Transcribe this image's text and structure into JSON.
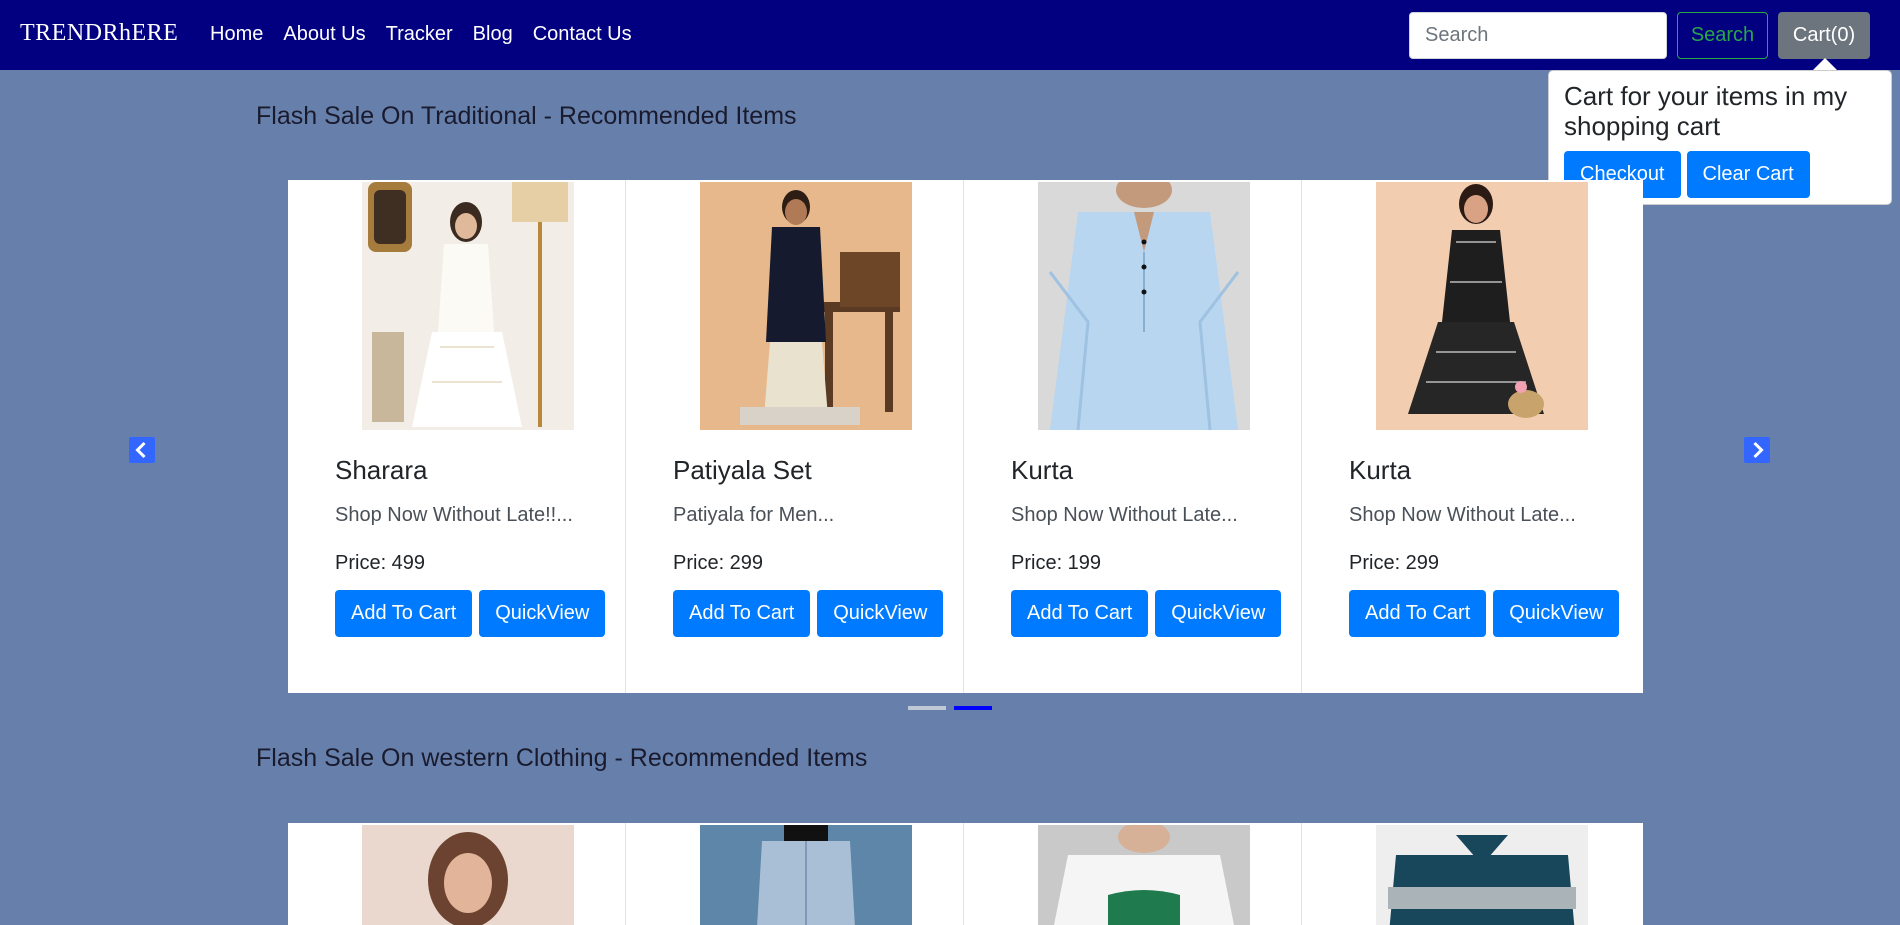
{
  "navbar": {
    "brand": "TRENDRhERE",
    "links": [
      "Home",
      "About Us",
      "Tracker",
      "Blog",
      "Contact Us"
    ],
    "search_placeholder": "Search",
    "search_button": "Search",
    "cart_button": "Cart(0)"
  },
  "cart_popover": {
    "title": "Cart for your items in my shopping cart",
    "checkout": "Checkout",
    "clear": "Clear Cart"
  },
  "sections": [
    {
      "title": "Flash Sale On Traditional - Recommended Items",
      "products": [
        {
          "name": "Sharara",
          "desc": "Shop Now Without Late!!...",
          "price": "Price: 499",
          "add": "Add To Cart",
          "quick": "QuickView"
        },
        {
          "name": "Patiyala Set",
          "desc": "Patiyala for Men...",
          "price": "Price: 299",
          "add": "Add To Cart",
          "quick": "QuickView"
        },
        {
          "name": "Kurta",
          "desc": "Shop Now Without Late...",
          "price": "Price: 199",
          "add": "Add To Cart",
          "quick": "QuickView"
        },
        {
          "name": "Kurta",
          "desc": "Shop Now Without Late...",
          "price": "Price: 299",
          "add": "Add To Cart",
          "quick": "QuickView"
        }
      ]
    },
    {
      "title": "Flash Sale On western Clothing - Recommended Items"
    }
  ],
  "colors": {
    "navbar": "#020080",
    "background": "#6680ab",
    "primary": "#007bff",
    "search_outline": "#28a745"
  },
  "icons": {
    "prev": "chevron-left-icon",
    "next": "chevron-right-icon"
  }
}
